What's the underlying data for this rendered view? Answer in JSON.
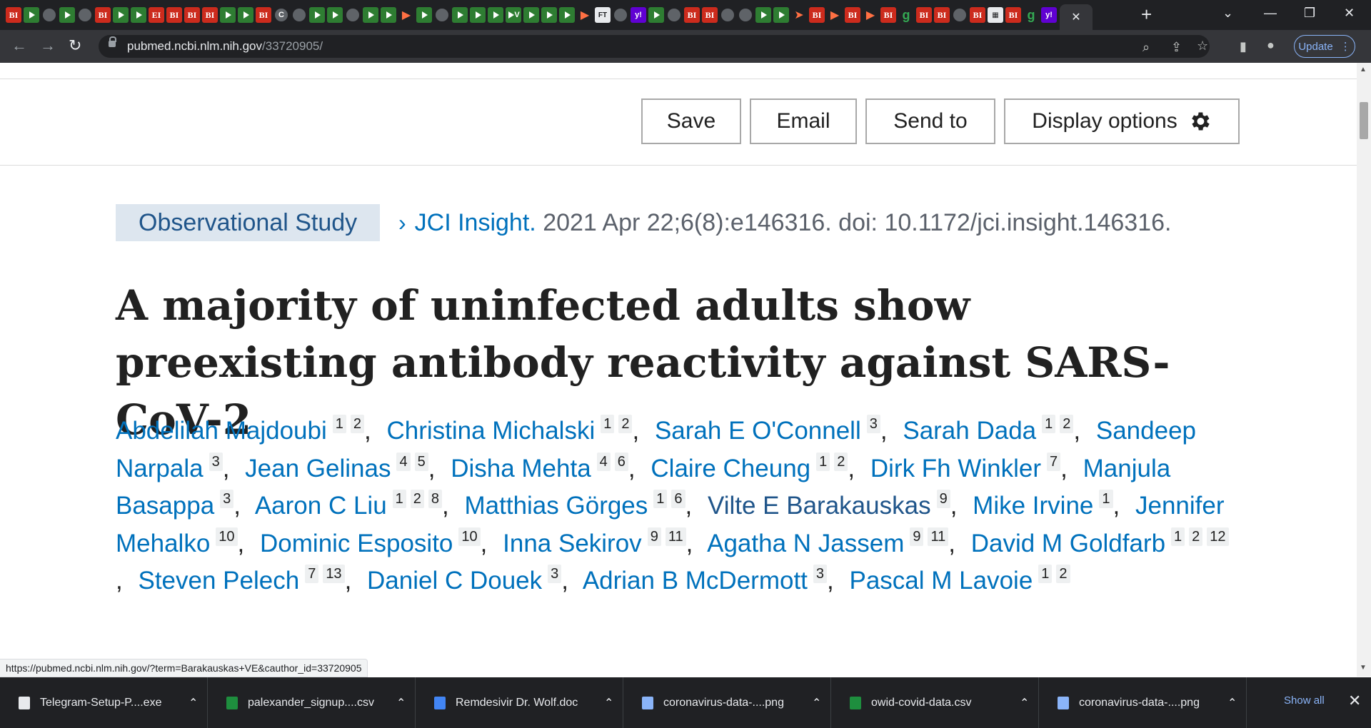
{
  "browser": {
    "url_host": "pubmed.ncbi.nlm.nih.gov",
    "url_path": "/33720905/",
    "update_label": "Update",
    "tab_favicons": [
      "bi",
      "play",
      "globe",
      "play",
      "globe",
      "bi",
      "play",
      "play",
      "ei",
      "bi",
      "bi",
      "bi",
      "play",
      "play",
      "bi",
      "c",
      "globe",
      "play",
      "play",
      "globe",
      "play",
      "play",
      "flag",
      "play",
      "globe",
      "play",
      "play",
      "play",
      "v",
      "play",
      "play",
      "play",
      "flag",
      "ft",
      "globe",
      "y",
      "play",
      "globe",
      "bi",
      "bi",
      "globe",
      "globe",
      "play",
      "play",
      "arrow",
      "bi",
      "flag",
      "bi",
      "flag",
      "bi",
      "g",
      "bi",
      "bi",
      "globe",
      "bi",
      "doc",
      "bi",
      "g",
      "y"
    ]
  },
  "actions": {
    "save": "Save",
    "email": "Email",
    "send_to": "Send to",
    "display_options": "Display options"
  },
  "article": {
    "publication_type": "Observational Study",
    "journal": "JCI Insight.",
    "citation": "2021 Apr 22;6(8):e146316. doi: 10.1172/jci.insight.146316.",
    "title": "A majority of uninfected adults show preexisting antibody reactivity against SARS-CoV-2",
    "authors": [
      {
        "name": "Abdelilah Majdoubi",
        "affs": [
          "1",
          "2"
        ]
      },
      {
        "name": "Christina Michalski",
        "affs": [
          "1",
          "2"
        ]
      },
      {
        "name": "Sarah E O'Connell",
        "affs": [
          "3"
        ]
      },
      {
        "name": "Sarah Dada",
        "affs": [
          "1",
          "2"
        ]
      },
      {
        "name": "Sandeep Narpala",
        "affs": [
          "3"
        ]
      },
      {
        "name": "Jean Gelinas",
        "affs": [
          "4",
          "5"
        ]
      },
      {
        "name": "Disha Mehta",
        "affs": [
          "4",
          "6"
        ]
      },
      {
        "name": "Claire Cheung",
        "affs": [
          "1",
          "2"
        ]
      },
      {
        "name": "Dirk Fh Winkler",
        "affs": [
          "7"
        ]
      },
      {
        "name": "Manjula Basappa",
        "affs": [
          "3"
        ]
      },
      {
        "name": "Aaron C Liu",
        "affs": [
          "1",
          "2",
          "8"
        ]
      },
      {
        "name": "Matthias Görges",
        "affs": [
          "1",
          "6"
        ]
      },
      {
        "name": "Vilte E Barakauskas",
        "affs": [
          "9"
        ]
      },
      {
        "name": "Mike Irvine",
        "affs": [
          "1"
        ]
      },
      {
        "name": "Jennifer Mehalko",
        "affs": [
          "10"
        ]
      },
      {
        "name": "Dominic Esposito",
        "affs": [
          "10"
        ]
      },
      {
        "name": "Inna Sekirov",
        "affs": [
          "9",
          "11"
        ]
      },
      {
        "name": "Agatha N Jassem",
        "affs": [
          "9",
          "11"
        ]
      },
      {
        "name": "David M Goldfarb",
        "affs": [
          "1",
          "2",
          "12"
        ]
      },
      {
        "name": "Steven Pelech",
        "affs": [
          "7",
          "13"
        ]
      },
      {
        "name": "Daniel C Douek",
        "affs": [
          "3"
        ]
      },
      {
        "name": "Adrian B McDermott",
        "affs": [
          "3"
        ]
      },
      {
        "name": "Pascal M Lavoie",
        "affs": [
          "1",
          "2"
        ]
      }
    ]
  },
  "status_url": "https://pubmed.ncbi.nlm.nih.gov/?term=Barakauskas+VE&cauthor_id=33720905",
  "downloads": {
    "items": [
      {
        "name": "Telegram-Setup-P....exe",
        "type": "exe",
        "color": "#e8eaed"
      },
      {
        "name": "palexander_signup....csv",
        "type": "csv",
        "color": "#1e8e3e"
      },
      {
        "name": "Remdesivir Dr. Wolf.doc",
        "type": "doc",
        "color": "#4285f4"
      },
      {
        "name": "coronavirus-data-....png",
        "type": "png",
        "color": "#8ab4f8"
      },
      {
        "name": "owid-covid-data.csv",
        "type": "csv",
        "color": "#1e8e3e"
      },
      {
        "name": "coronavirus-data-....png",
        "type": "png",
        "color": "#8ab4f8"
      }
    ],
    "show_all": "Show all"
  }
}
